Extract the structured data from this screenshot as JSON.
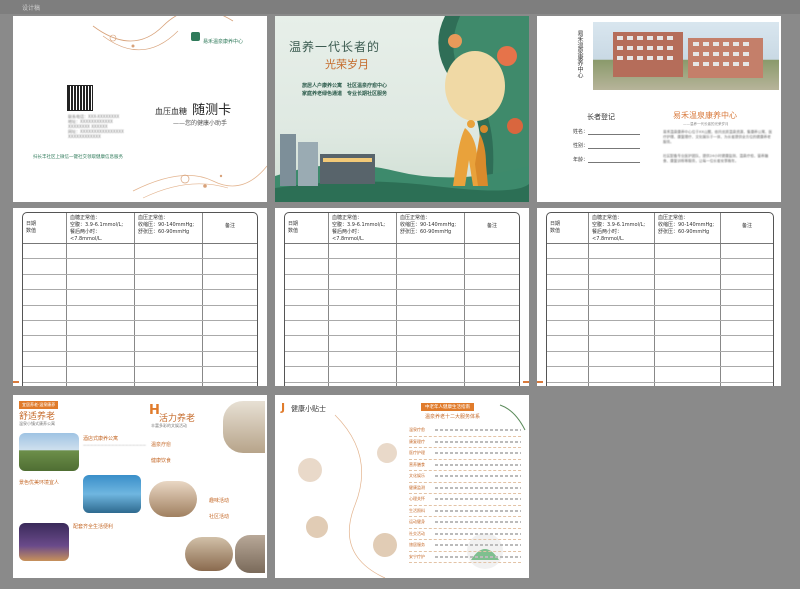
{
  "window": {
    "title": "设计稿"
  },
  "cover": {
    "org_name": "易禾温泉康养中心",
    "title_small": "血压血糖",
    "title_big": "随测卡",
    "subtitle": "——您的健康小助手",
    "contact_lines": [
      "联系电话：XXX-XXXXXXXX",
      "地址：XXXXXXXXXXXX",
      "XXXXXXXX XXXXXX",
      "网址：XXXXXXXXXXXXXXXX",
      "XXXXXXXXXXXX"
    ],
    "slogan": "扫长丰社区上微信一键社交领取健康信息服务"
  },
  "poster": {
    "headline": "温养一代长者的",
    "headline2": "光荣岁月",
    "line1": "旅居人户康养公寓　社区温泉疗愈中心",
    "line2": "家庭养老绿色通道　专业长期社区服务"
  },
  "profile": {
    "vertical_title": "易禾温泉康养中心",
    "elder_reg": "长者登记",
    "fields": [
      "姓名：",
      "性别：",
      "年龄："
    ],
    "center_title": "易禾温泉康养中心",
    "center_sub": "——温养一代长者的光荣岁月",
    "para1": "易禾温泉康养中心位于XX山麓，依托优质温泉资源，集康养公寓、医疗护理、康复理疗、文化娱乐于一体，为长者提供全方位的健康养老服务。",
    "para2": "社区配备专业医护团队，提供24小时健康监测、温泉疗愈、营养膳食、康复训练等服务，让每一位长者安享晚年。"
  },
  "record": {
    "col_date": "日期\n数值",
    "sugar_title": "血糖正常值：",
    "sugar_fasting": "空腹：3.9-6.1mmol/L;",
    "sugar_after": "餐后两小时：<7.8mmol/L.",
    "bp_title": "血压正常值：",
    "bp_sys": "收缩压：90-140mmHg;",
    "bp_dia": "舒张压：60-90mmHg",
    "col_note": "备注",
    "rows": 10
  },
  "spread1": {
    "tag": "宜居养老·温泉康养",
    "heading1": "舒适养老",
    "sub1": "温泉小镇式康养公寓",
    "sec_a": "酒店式康养公寓",
    "sec_b": "景色优美环境宜人",
    "sec_c": "配套齐全生活便利",
    "h_letter": "H",
    "heading2": "活力养老",
    "sub2": "丰富多彩的文娱活动",
    "sec_d": "温泉疗愈",
    "sec_e": "健康饮食",
    "sec_f": "趣味活动",
    "sec_g": "社区活动"
  },
  "spread2": {
    "j_letter": "J",
    "heading": "健康小贴士",
    "banner": "中老年人健康生活指南",
    "banner2": "温泉养老十二大服务体系",
    "items": [
      "温泉疗愈",
      "康复理疗",
      "医疗护理",
      "营养膳食",
      "文化娱乐",
      "健康监测",
      "心理关怀",
      "生活照料",
      "运动健身",
      "社交活动",
      "旅居服务",
      "安宁疗护"
    ]
  },
  "colors": {
    "accent": "#d97a3c",
    "green": "#2f7a5a",
    "orange": "#e07b2b"
  }
}
